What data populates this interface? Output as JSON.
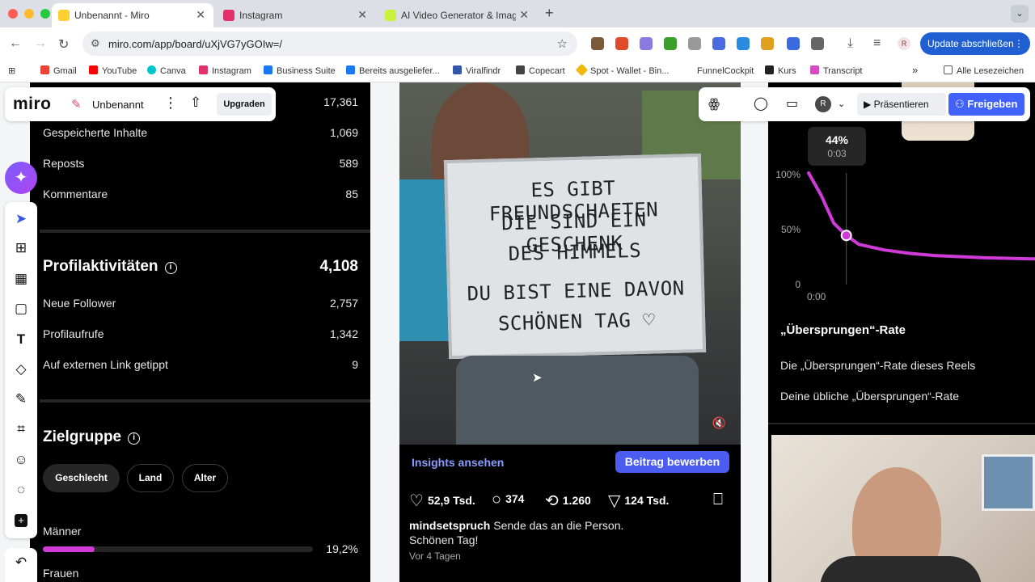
{
  "browser": {
    "tabs": [
      {
        "title": "Unbenannt - Miro",
        "active": true,
        "color": "#ffd02f"
      },
      {
        "title": "Instagram",
        "active": false,
        "color": "#e1306c"
      },
      {
        "title": "AI Video Generator & Image G",
        "active": false,
        "color": "#c8f23c"
      }
    ],
    "new_tab": "+",
    "url": "miro.com/app/board/uXjVG7yGOIw=/",
    "update_button": "Update abschließen",
    "profile_initial": "R",
    "bookmarks": [
      {
        "label": "Gmail",
        "color": "#ea4335"
      },
      {
        "label": "YouTube",
        "color": "#ff0000"
      },
      {
        "label": "Canva",
        "color": "#00c4cc"
      },
      {
        "label": "Instagram",
        "color": "#e1306c"
      },
      {
        "label": "Business Suite",
        "color": "#1877f2"
      },
      {
        "label": "Bereits ausgeliefer...",
        "color": "#1877f2"
      },
      {
        "label": "Viralfindr",
        "color": "#3355aa"
      },
      {
        "label": "Copecart",
        "color": "#444444"
      },
      {
        "label": "Spot - Wallet - Bin...",
        "color": "#f0b90b"
      },
      {
        "label": "FunnelCockpit",
        "color": "#ffffff"
      },
      {
        "label": "Kurs",
        "color": "#222222"
      },
      {
        "label": "Transcript",
        "color": "#d44cc0"
      }
    ],
    "bookmarks_more": "»",
    "all_bookmarks": "Alle Lesezeichen"
  },
  "miro": {
    "logo": "miro",
    "board_name": "Unbenannt",
    "upgrade_label": "Upgraden",
    "present_label": "Präsentieren",
    "share_label": "Freigeben",
    "avatar_initial": "R",
    "accent": "#4262ff",
    "tools": [
      "select",
      "templates",
      "frame",
      "sticky-note",
      "text",
      "shapes",
      "pen",
      "crop-frame",
      "reaction",
      "comment",
      "add"
    ]
  },
  "left": {
    "top_value": "17,361",
    "interactions": [
      {
        "label": "Gespeicherte Inhalte",
        "value": "1,069"
      },
      {
        "label": "Reposts",
        "value": "589"
      },
      {
        "label": "Kommentare",
        "value": "85"
      }
    ],
    "profile_title": "Profilaktivitäten",
    "profile_total": "4,108",
    "profile_rows": [
      {
        "label": "Neue Follower",
        "value": "2,757"
      },
      {
        "label": "Profilaufrufe",
        "value": "1,342"
      },
      {
        "label": "Auf externen Link getippt",
        "value": "9"
      }
    ],
    "audience_title": "Zielgruppe",
    "audience_tabs": [
      "Geschlecht",
      "Land",
      "Alter"
    ],
    "gender": [
      {
        "label": "Männer",
        "percent": "19,2%",
        "fraction": 0.192
      },
      {
        "label": "Frauen"
      }
    ],
    "bar_color": "#d03ad8"
  },
  "post": {
    "sign_lines": [
      "ES GIBT FREUNDSCHAFTEN",
      "DIE SIND EIN GESCHENK",
      "DES HIMMELS",
      "DU BIST EINE DAVON",
      "SCHÖNEN TAG ♡"
    ],
    "insights_label": "Insights ansehen",
    "promote_label": "Beitrag bewerben",
    "likes": "52,9 Tsd.",
    "comments": "374",
    "reposts": "1.260",
    "shares": "124 Tsd.",
    "username": "mindsetspruch",
    "caption_line1": "Sende das an die Person.",
    "caption_line2": "Schönen Tag!",
    "time": "Vor 4 Tagen"
  },
  "retention": {
    "tooltip_percent": "44%",
    "tooltip_time": "0:03",
    "y_labels": [
      "100%",
      "50%",
      "0"
    ],
    "x_label": "0:00",
    "curve_color": "#d03ad8",
    "skip_title": "„Übersprungen“-Rate",
    "skip_rows": [
      "Die „Übersprungen“-Rate dieses Reels",
      "Deine übliche „Übersprungen“-Rate"
    ]
  },
  "chart_data": {
    "type": "line",
    "title": "",
    "xlabel": "",
    "ylabel": "",
    "x": [
      "0:00",
      "0:01",
      "0:02",
      "0:03",
      "0:04",
      "0:06",
      "0:08",
      "0:10",
      "0:14",
      "0:18"
    ],
    "values": [
      100,
      80,
      55,
      44,
      36,
      31,
      28,
      26,
      24,
      23
    ],
    "ylim": [
      0,
      100
    ],
    "highlight": {
      "x": "0:03",
      "y": 44
    },
    "grid": false
  }
}
